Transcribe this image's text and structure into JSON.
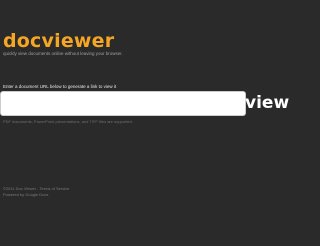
{
  "brand": {
    "name": "docviewer",
    "tagline": "quickly view documents online without leaving your browser."
  },
  "form": {
    "prompt": "Enter a document URL below to generate a link to view it",
    "url_value": "",
    "url_placeholder": "",
    "view_label": "view",
    "formats_note": "PDF documents, PowerPoint presentations, and TIFF files are supported."
  },
  "footer": {
    "copyright": "©2011 Doc Viewer",
    "separator": " - ",
    "terms_link": "Terms of Service",
    "powered_by": "Powered by Google Docs"
  },
  "colors": {
    "background": "#2a2a2a",
    "brand_orange": "#f5a623",
    "button_text": "#ffffff"
  }
}
